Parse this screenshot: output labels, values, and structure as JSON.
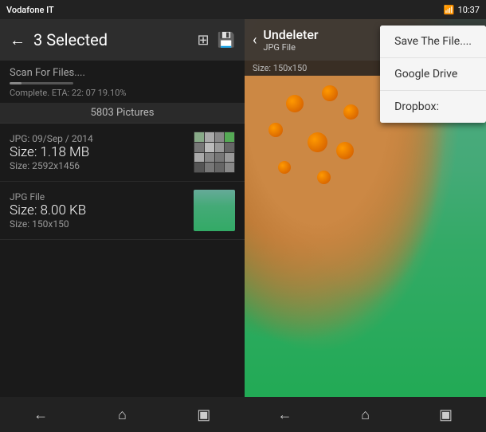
{
  "statusBar": {
    "carrier": "Vodafone IT",
    "time": "10:37",
    "icons": [
      "signal",
      "wifi",
      "battery"
    ]
  },
  "leftPanel": {
    "toolbar": {
      "backLabel": "←",
      "title": "3 Selected",
      "gridIcon": "⊞",
      "saveIcon": "💾"
    },
    "scan": {
      "label": "Scan For Files....",
      "progressPercent": 19,
      "status": "Complete. ETA: 22: 07 19.10%"
    },
    "picturesHeader": "5803 Pictures",
    "files": [
      {
        "type": "JPG: 09/Sep / 2014",
        "sizeMB": "Size: 1.18 MB",
        "dimensions": "Size: 2592x1456"
      },
      {
        "type": "JPG File",
        "sizeMB": "Size: 8.00 KB",
        "dimensions": "Size: 150x150"
      }
    ]
  },
  "rightPanel": {
    "toolbar": {
      "backLabel": "‹",
      "titleMain": "Undeleter",
      "titleSub": "JPG File",
      "moreIcon": "⋮"
    },
    "sizeInfo": "Size: 150x150",
    "dropdown": {
      "items": [
        "Save The File....",
        "Google Drive",
        "Dropbox:"
      ]
    }
  },
  "navBar": {
    "leftButtons": [
      "←",
      "⌂",
      "▣"
    ],
    "rightButtons": [
      "←",
      "⌂",
      "▣"
    ]
  }
}
